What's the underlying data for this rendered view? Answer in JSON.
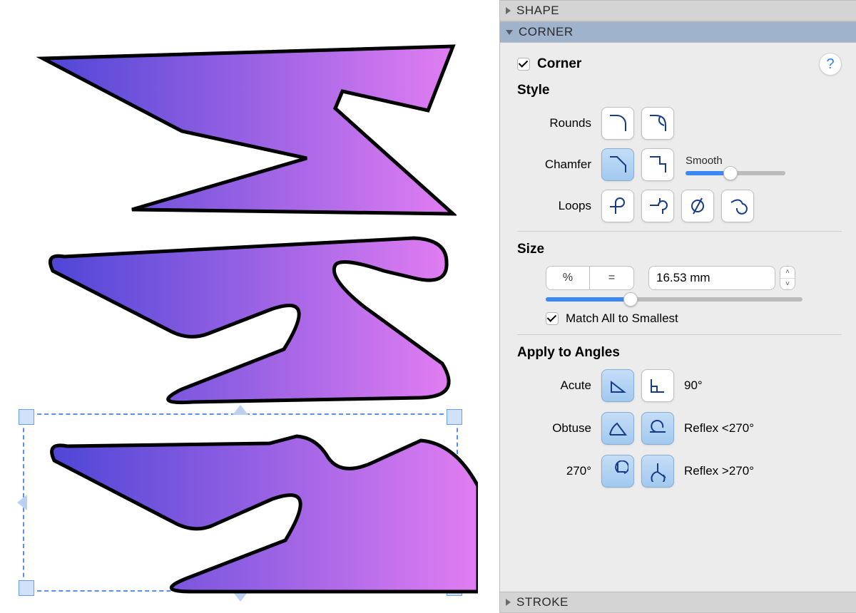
{
  "panel": {
    "shape_header": "SHAPE",
    "stroke_header": "STROKE",
    "corner_header": "CORNER",
    "corner_checkbox_label": "Corner",
    "help_glyph": "?",
    "style_label": "Style",
    "rounds_label": "Rounds",
    "chamfer_label": "Chamfer",
    "loops_label": "Loops",
    "smooth_label": "Smooth",
    "smooth_value": 45,
    "size_label": "Size",
    "unit_percent": "%",
    "unit_eq": "=",
    "size_value": "16.53 mm",
    "size_slider_value": 33,
    "match_label": "Match All to Smallest",
    "apply_label": "Apply to Angles",
    "acute_label": "Acute",
    "ninety_label": "90°",
    "obtuse_label": "Obtuse",
    "reflex_lt_label": "Reflex <270°",
    "two_seventy_label": "270°",
    "reflex_gt_label": "Reflex >270°"
  },
  "colors": {
    "gradient_start": "#4e46d6",
    "gradient_end": "#e17df1"
  }
}
